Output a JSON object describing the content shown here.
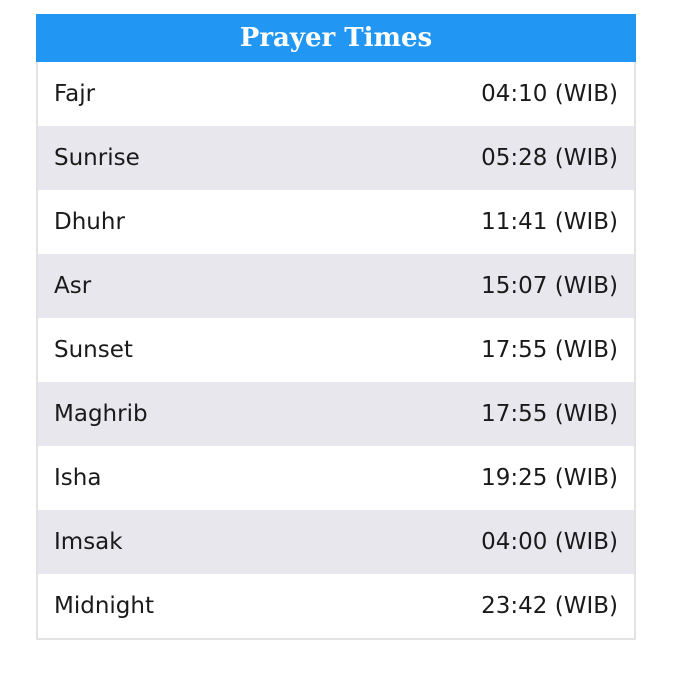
{
  "title": "Prayer Times",
  "rows": [
    {
      "name": "Fajr",
      "time": "04:10 (WIB)"
    },
    {
      "name": "Sunrise",
      "time": "05:28 (WIB)"
    },
    {
      "name": "Dhuhr",
      "time": "11:41 (WIB)"
    },
    {
      "name": "Asr",
      "time": "15:07 (WIB)"
    },
    {
      "name": "Sunset",
      "time": "17:55 (WIB)"
    },
    {
      "name": "Maghrib",
      "time": "17:55 (WIB)"
    },
    {
      "name": "Isha",
      "time": "19:25 (WIB)"
    },
    {
      "name": "Imsak",
      "time": "04:00 (WIB)"
    },
    {
      "name": "Midnight",
      "time": "23:42 (WIB)"
    }
  ],
  "colors": {
    "header_bg": "#2196f3",
    "header_text": "#ffffff",
    "alt_row_bg": "#e8e7ee",
    "row_bg": "#ffffff"
  }
}
